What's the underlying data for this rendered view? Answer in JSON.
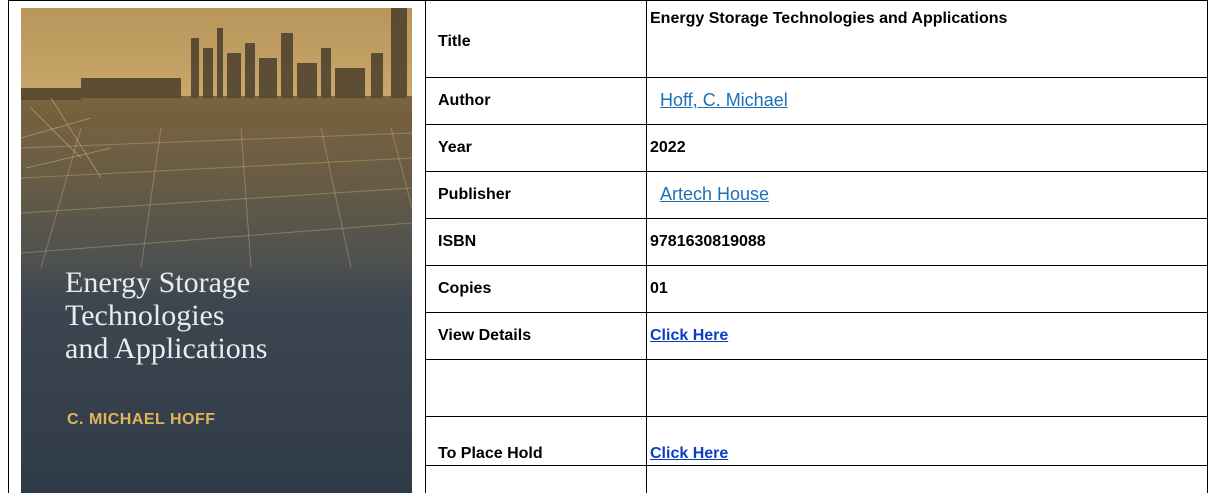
{
  "cover": {
    "title_lines": [
      "Energy Storage",
      "Technologies",
      "and Applications"
    ],
    "author": "C. MICHAEL HOFF"
  },
  "rows": {
    "title": {
      "label": "Title",
      "value": "Energy Storage Technologies and Applications"
    },
    "author": {
      "label": "Author",
      "value": "Hoff, C. Michael"
    },
    "year": {
      "label": "Year",
      "value": "2022"
    },
    "publisher": {
      "label": "Publisher",
      "value": "Artech House"
    },
    "isbn": {
      "label": "ISBN",
      "value": "9781630819088"
    },
    "copies": {
      "label": "Copies",
      "value": "01"
    },
    "view_details": {
      "label": "View Details",
      "value": "Click Here"
    },
    "place_hold": {
      "label": "To Place Hold",
      "value": "Click Here"
    }
  },
  "colors": {
    "link": "#1f6fb5",
    "bold_link": "#0b3fc2",
    "cover_author": "#e0b55a"
  }
}
